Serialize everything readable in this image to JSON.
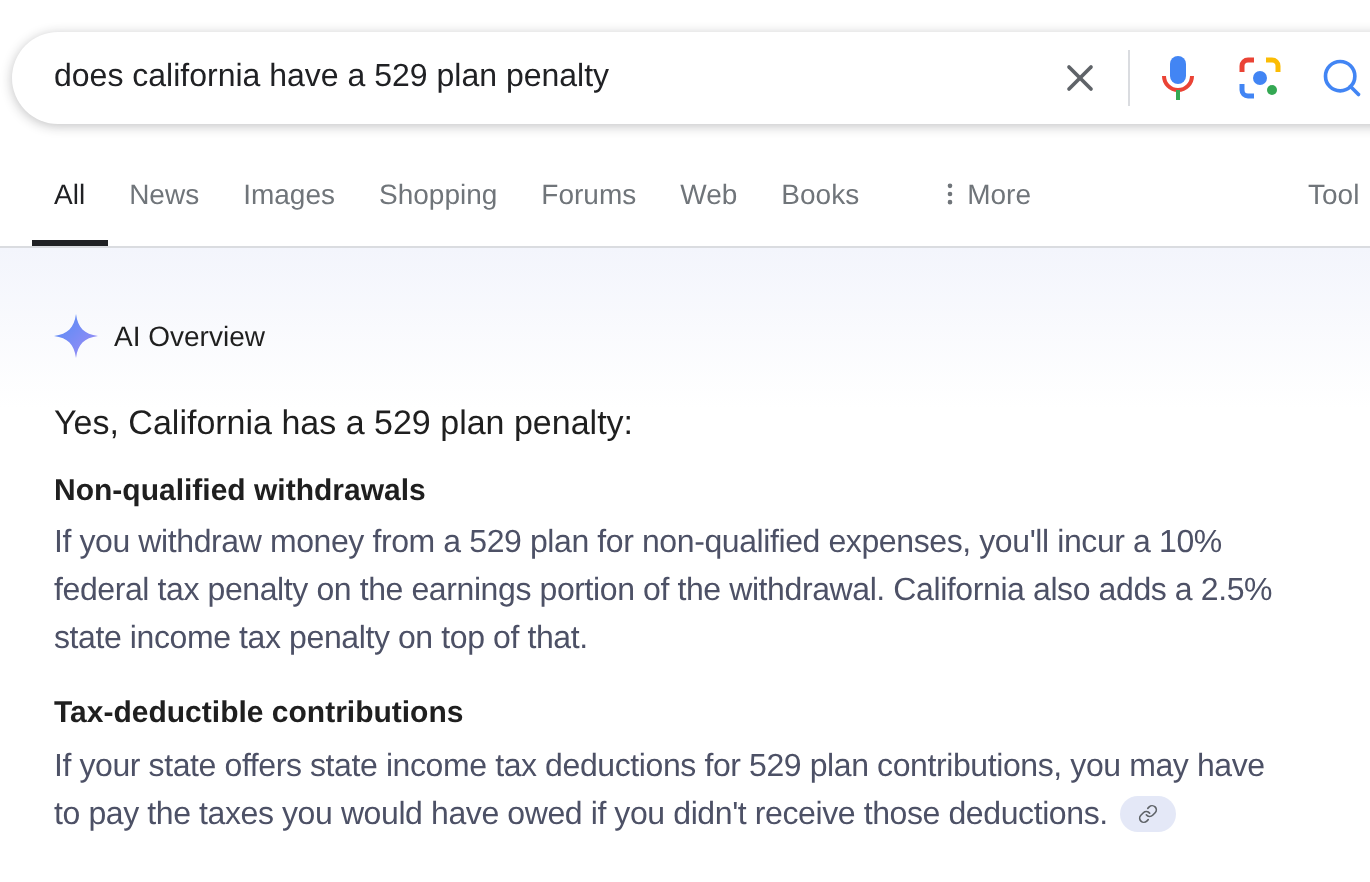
{
  "search": {
    "value": "does california have a 529 plan penalty"
  },
  "tabs": [
    {
      "label": "All",
      "selected": true
    },
    {
      "label": "News",
      "selected": false
    },
    {
      "label": "Images",
      "selected": false
    },
    {
      "label": "Shopping",
      "selected": false
    },
    {
      "label": "Forums",
      "selected": false
    },
    {
      "label": "Web",
      "selected": false
    },
    {
      "label": "Books",
      "selected": false
    },
    {
      "label": "More",
      "selected": false,
      "kind": "menu"
    }
  ],
  "tools": "Tool",
  "ai_overview": {
    "title": "AI Overview",
    "lead": "Yes, California has a 529 plan penalty:",
    "sections": [
      {
        "heading": "Non-qualified withdrawals",
        "text": "If you withdraw money from a 529 plan for non-qualified expenses, you'll incur a 10% federal tax penalty on the earnings portion of the withdrawal. California also adds a 2.5% state income tax penalty on top of that."
      },
      {
        "heading": "Tax-deductible contributions",
        "text": "If your state offers state income tax deductions for 529 plan contributions, you may have to pay the taxes you would have owed if you didn't receive those deductions.",
        "link": true
      }
    ]
  }
}
